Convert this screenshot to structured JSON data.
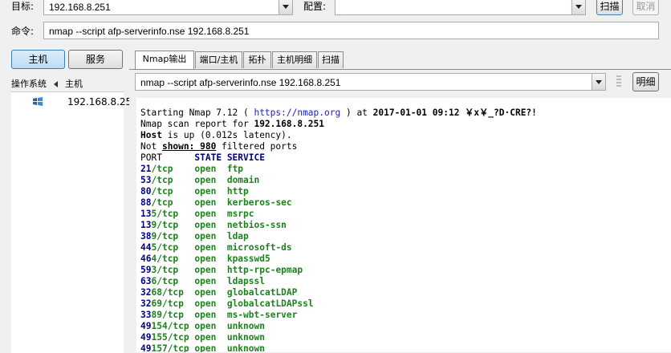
{
  "toolbar": {
    "target_label": "目标:",
    "target_value": "192.168.8.251",
    "profile_label": "配置:",
    "profile_value": "",
    "scan_button": "扫描",
    "cancel_button": "取消",
    "command_label": "命令:",
    "command_value": "nmap --script afp-serverinfo.nse 192.168.8.251"
  },
  "left_panel": {
    "hosts_button": "主机",
    "services_button": "服务",
    "col_os": "操作系统",
    "col_host": "主机",
    "hosts": [
      {
        "ip": "192.168.8.25",
        "icon": "windows-icon"
      }
    ]
  },
  "tabs": [
    "Nmap输出",
    "端口/主机",
    "拓扑",
    "主机明细",
    "扫描"
  ],
  "output_panel": {
    "command_select": "nmap --script afp-serverinfo.nse 192.168.8.251",
    "details_button": "明细"
  },
  "output": {
    "start_prefix": "Starting Nmap 7.12 ( ",
    "start_url": "https://nmap.org",
    "start_mid": " ) at ",
    "start_time": "2017-01-01 09:12",
    "start_tail": " ￥x￥_?D·CRE?!",
    "report_prefix": "Nmap scan report for ",
    "report_ip": "192.168.8.251",
    "host_word": "Host",
    "host_tail": " is up (0.012s latency).",
    "notshown_prefix": "Not ",
    "notshown_mid": "shown: 980",
    "notshown_tail": " filtered ports",
    "col_port": "PORT",
    "col_state": "STATE",
    "col_service": "SERVICE",
    "ports": [
      {
        "port": "21/tcp",
        "state": "open",
        "service": "ftp"
      },
      {
        "port": "53/tcp",
        "state": "open",
        "service": "domain"
      },
      {
        "port": "80/tcp",
        "state": "open",
        "service": "http"
      },
      {
        "port": "88/tcp",
        "state": "open",
        "service": "kerberos-sec"
      },
      {
        "port": "135/tcp",
        "state": "open",
        "service": "msrpc"
      },
      {
        "port": "139/tcp",
        "state": "open",
        "service": "netbios-ssn"
      },
      {
        "port": "389/tcp",
        "state": "open",
        "service": "ldap"
      },
      {
        "port": "445/tcp",
        "state": "open",
        "service": "microsoft-ds"
      },
      {
        "port": "464/tcp",
        "state": "open",
        "service": "kpasswd5"
      },
      {
        "port": "593/tcp",
        "state": "open",
        "service": "http-rpc-epmap"
      },
      {
        "port": "636/tcp",
        "state": "open",
        "service": "ldapssl"
      },
      {
        "port": "3268/tcp",
        "state": "open",
        "service": "globalcatLDAP"
      },
      {
        "port": "3269/tcp",
        "state": "open",
        "service": "globalcatLDAPssl"
      },
      {
        "port": "3389/tcp",
        "state": "open",
        "service": "ms-wbt-server"
      },
      {
        "port": "49154/tcp",
        "state": "open",
        "service": "unknown"
      },
      {
        "port": "49155/tcp",
        "state": "open",
        "service": "unknown"
      },
      {
        "port": "49157/tcp",
        "state": "open",
        "service": "unknown"
      }
    ]
  }
}
